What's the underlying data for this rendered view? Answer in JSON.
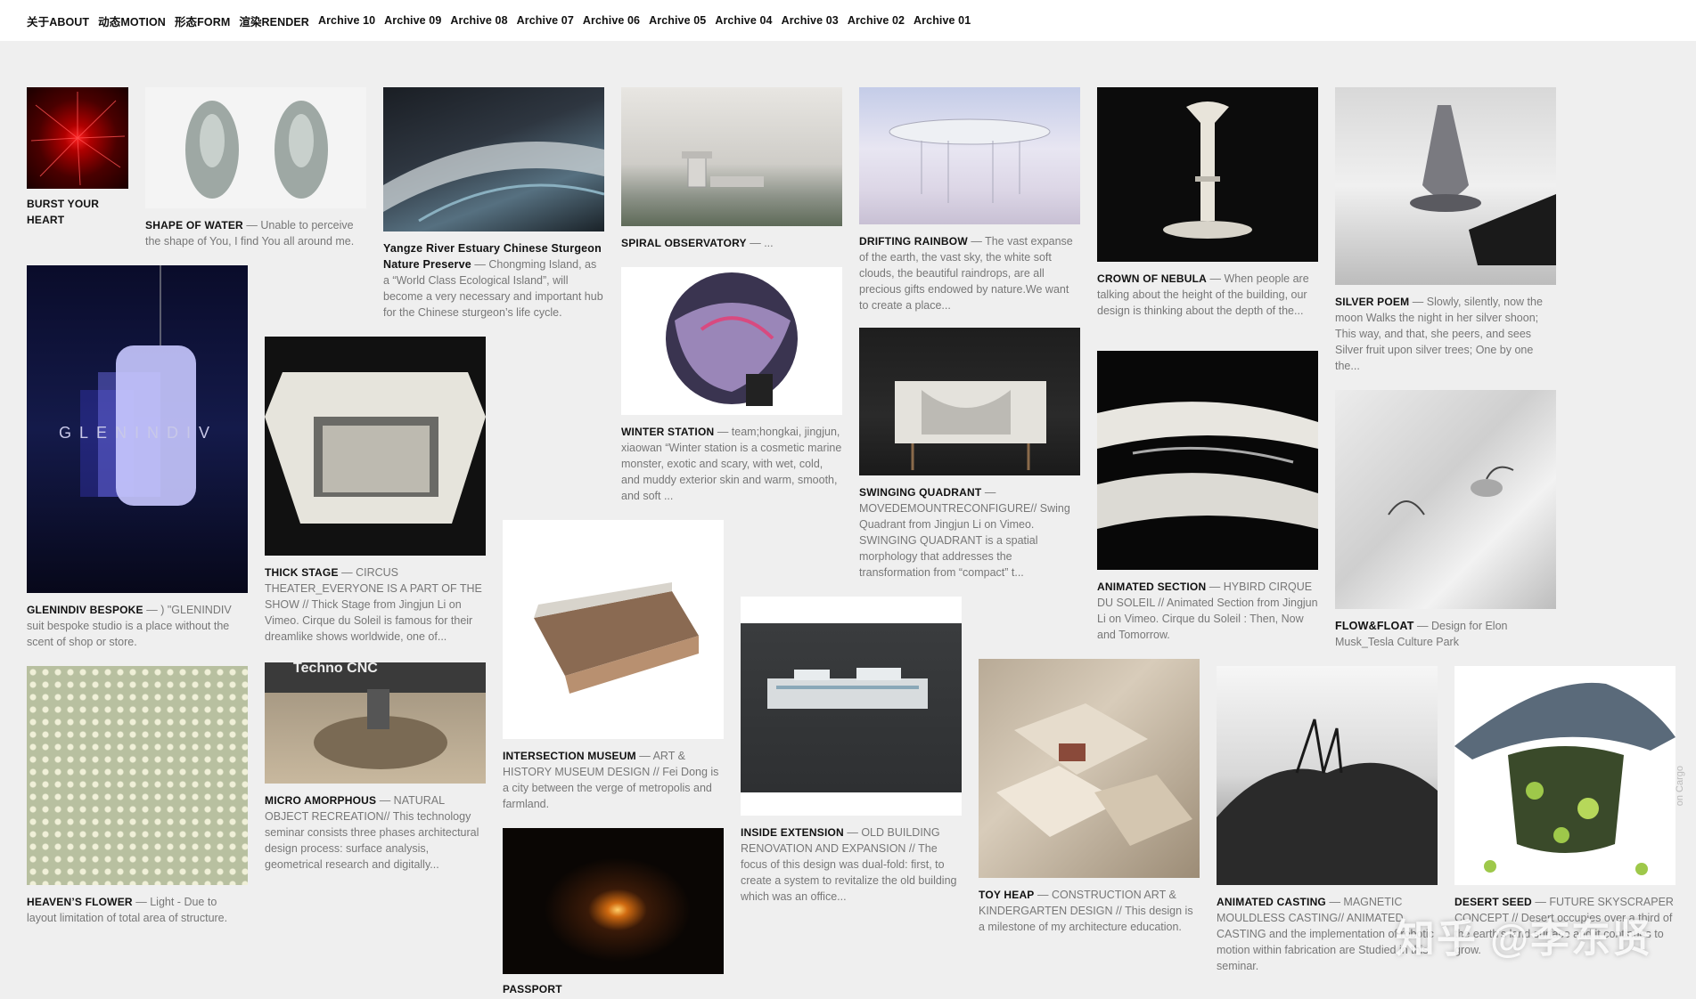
{
  "nav": {
    "items": [
      "关于ABOUT",
      "动态MOTION",
      "形态FORM",
      "渲染RENDER",
      "Archive 10",
      "Archive 09",
      "Archive 08",
      "Archive 07",
      "Archive 06",
      "Archive 05",
      "Archive 04",
      "Archive 03",
      "Archive 02",
      "Archive 01"
    ]
  },
  "projects": [
    {
      "title": "BURST YOUR HEART",
      "desc": ""
    },
    {
      "title": "SHAPE OF WATER",
      "desc": " — Unable to perceive the shape of You, I find You all around me."
    },
    {
      "title": "Yangze River Estuary Chinese Sturgeon Nature Preserve",
      "desc": " — Chongming Island, as a “World Class Ecological Island”, will become a very necessary and important hub for the Chinese sturgeon’s life cycle."
    },
    {
      "title": "SPIRAL OBSERVATORY",
      "desc": " — ..."
    },
    {
      "title": "DRIFTING RAINBOW",
      "desc": " — The vast expanse of the earth, the vast sky, the white soft clouds, the beautiful raindrops, are all precious gifts endowed by nature.We want to create a place..."
    },
    {
      "title": "CROWN OF NEBULA",
      "desc": " — When people are talking about the height of the building, our design is thinking about the depth of the..."
    },
    {
      "title": "SILVER POEM",
      "desc": " — Slowly, silently, now the moon Walks the night in her silver shoon; This way, and that, she peers, and sees Silver fruit upon silver trees; One by one the..."
    },
    {
      "title": "GLENINDIV BESPOKE",
      "desc": " — ) \"GLENINDIV suit bespoke studio is a place without the scent of shop or store."
    },
    {
      "title": "THICK STAGE",
      "desc": " — CIRCUS THEATER_EVERYONE IS A PART OF THE SHOW // Thick Stage from Jingjun Li on Vimeo. Cirque du Soleil is famous for their dreamlike shows worldwide, one of..."
    },
    {
      "title": "WINTER STATION",
      "desc": " — team;hongkai, jingjun, xiaowan “Winter station is a cosmetic marine monster, exotic and scary, with wet, cold, and muddy exterior skin and warm, smooth, and soft ..."
    },
    {
      "title": "SWINGING QUADRANT",
      "desc": " — MOVEDEMOUNTRECONFIGURE// Swing Quadrant from Jingjun Li on Vimeo. SWINGING QUADRANT is a spatial morphology that addresses the transformation from “compact” t..."
    },
    {
      "title": "ANIMATED SECTION",
      "desc": " — HYBIRD CIRQUE DU SOLEIL // Animated Section from Jingjun Li on Vimeo. Cirque du Soleil : Then, Now and Tomorrow."
    },
    {
      "title": "FLOW&FLOAT",
      "desc": " — Design for Elon Musk_Tesla Culture Park"
    },
    {
      "title": "HEAVEN’S FLOWER",
      "desc": " — Light - Due to layout limitation of total area of structure."
    },
    {
      "title": "MICRO AMORPHOUS",
      "desc": " — NATURAL OBJECT RECREATION// This technology seminar consists three phases architectural design process: surface analysis, geometrical research and digitally..."
    },
    {
      "title": "INTERSECTION MUSEUM",
      "desc": " — ART & HISTORY MUSEUM DESIGN // Fei Dong is a city between the verge of metropolis and farmland."
    },
    {
      "title": "INSIDE EXTENSION",
      "desc": " — OLD BUILDING RENOVATION AND EXPANSION // The focus of this design was dual-fold: first, to create a system to revitalize the old building which was an office..."
    },
    {
      "title": "TOY HEAP",
      "desc": " — CONSTRUCTION ART & KINDERGARTEN DESIGN // This design is a milestone of my architecture education."
    },
    {
      "title": "ANIMATED CASTING",
      "desc": " — MAGNETIC MOULDLESS CASTING// ANIMATED CASTING and the implementation of robotic motion within fabrication are Studied in this seminar."
    },
    {
      "title": "DESERT SEED",
      "desc": " — FUTURE SKYSCRAPER CONCEPT // Desert occupies over a third of the earth’s land surface and it continues to grow."
    },
    {
      "title": "PASSPORT",
      "desc": ""
    }
  ],
  "overlay": {
    "watermark": "知乎 @李东贤",
    "glenindiv_text": "GLENINDIV",
    "cnc_text": "Techno CNC",
    "side_stamp": "on Cargo"
  }
}
